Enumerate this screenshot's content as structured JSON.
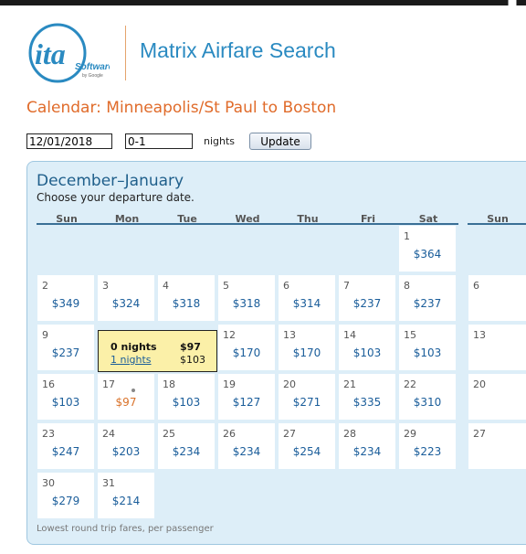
{
  "header": {
    "logo_text": "ita",
    "logo_sub": "Software",
    "logo_by": "by Google",
    "app_title": "Matrix Airfare Search"
  },
  "page_title": "Calendar: Minneapolis/St Paul to Boston",
  "controls": {
    "date_value": "12/01/2018",
    "nights_value": "0-1",
    "nights_label": "nights",
    "update_label": "Update"
  },
  "calendar": {
    "month_title": "December–January",
    "subtitle": "Choose your departure date.",
    "weekdays": [
      "Sun",
      "Mon",
      "Tue",
      "Wed",
      "Thu",
      "Fri",
      "Sat"
    ],
    "next_weekday": "Sun",
    "days": [
      {
        "day": "1",
        "price": "$364"
      },
      {
        "day": "2",
        "price": "$349"
      },
      {
        "day": "3",
        "price": "$324"
      },
      {
        "day": "4",
        "price": "$318"
      },
      {
        "day": "5",
        "price": "$318"
      },
      {
        "day": "6",
        "price": "$314"
      },
      {
        "day": "7",
        "price": "$237"
      },
      {
        "day": "8",
        "price": "$237"
      },
      {
        "day": "9",
        "price": "$237"
      },
      {
        "day": "12",
        "price": "$170"
      },
      {
        "day": "13",
        "price": "$170"
      },
      {
        "day": "14",
        "price": "$103"
      },
      {
        "day": "15",
        "price": "$103"
      },
      {
        "day": "16",
        "price": "$103"
      },
      {
        "day": "17",
        "price": "$97"
      },
      {
        "day": "18",
        "price": "$103"
      },
      {
        "day": "19",
        "price": "$127"
      },
      {
        "day": "20",
        "price": "$271"
      },
      {
        "day": "21",
        "price": "$335"
      },
      {
        "day": "22",
        "price": "$310"
      },
      {
        "day": "23",
        "price": "$247"
      },
      {
        "day": "24",
        "price": "$203"
      },
      {
        "day": "25",
        "price": "$234"
      },
      {
        "day": "26",
        "price": "$234"
      },
      {
        "day": "27",
        "price": "$254"
      },
      {
        "day": "28",
        "price": "$234"
      },
      {
        "day": "29",
        "price": "$223"
      },
      {
        "day": "30",
        "price": "$279"
      },
      {
        "day": "31",
        "price": "$214"
      }
    ],
    "next_month_days": [
      "6",
      "13",
      "20",
      "27"
    ],
    "popup": {
      "line1_label": "0 nights",
      "line1_price": "$97",
      "line2_label": "1 nights",
      "line2_price": "$103"
    },
    "footnote": "Lowest round trip fares, per passenger"
  },
  "colors": {
    "accent_blue": "#2a8ac1",
    "title_orange": "#e06b2a",
    "price_blue": "#1a5d9a",
    "highlight_price": "#d9722a",
    "panel_bg": "#ddeef8",
    "popup_bg": "#fbf0a8"
  }
}
